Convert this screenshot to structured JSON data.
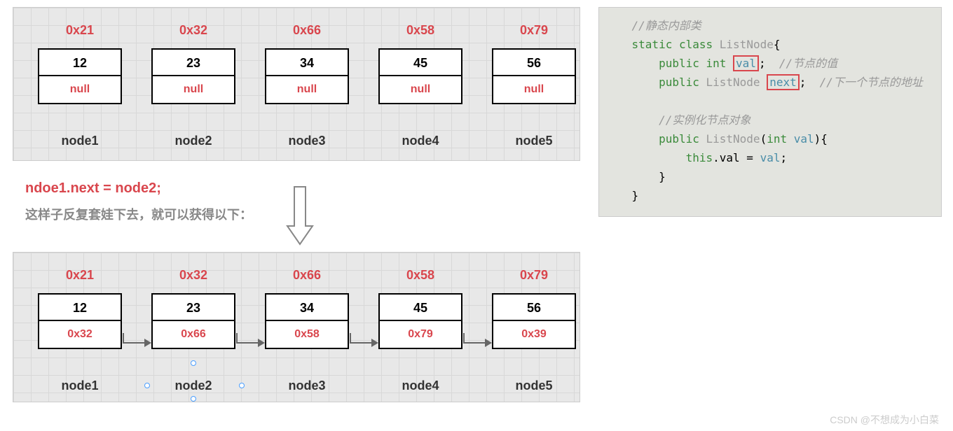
{
  "diagram1": {
    "nodes": [
      {
        "addr": "0x21",
        "val": "12",
        "ptr": "null",
        "name": "node1"
      },
      {
        "addr": "0x32",
        "val": "23",
        "ptr": "null",
        "name": "node2"
      },
      {
        "addr": "0x66",
        "val": "34",
        "ptr": "null",
        "name": "node3"
      },
      {
        "addr": "0x58",
        "val": "45",
        "ptr": "null",
        "name": "node4"
      },
      {
        "addr": "0x79",
        "val": "56",
        "ptr": "null",
        "name": "node5"
      }
    ]
  },
  "mid": {
    "assignment": "ndoe1.next = node2;",
    "desc": "这样子反复套娃下去，就可以获得以下："
  },
  "diagram2": {
    "nodes": [
      {
        "addr": "0x21",
        "val": "12",
        "ptr": "0x32",
        "name": "node1"
      },
      {
        "addr": "0x32",
        "val": "23",
        "ptr": "0x66",
        "name": "node2"
      },
      {
        "addr": "0x66",
        "val": "34",
        "ptr": "0x58",
        "name": "node3"
      },
      {
        "addr": "0x58",
        "val": "45",
        "ptr": "0x79",
        "name": "node4"
      },
      {
        "addr": "0x79",
        "val": "56",
        "ptr": "0x39",
        "name": "node5"
      }
    ]
  },
  "code": {
    "c1": "//静态内部类",
    "c2a": "static",
    "c2b": "class",
    "c2c": "ListNode",
    "c2d": "{",
    "c3a": "public",
    "c3b": "int",
    "c3c": "val",
    "c3d": ";",
    "c3e": "//节点的值",
    "c4a": "public",
    "c4b": "ListNode",
    "c4c": "next",
    "c4d": ";",
    "c4e": "//下一个节点的地址",
    "c5": "//实例化节点对象",
    "c6a": "public",
    "c6b": "ListNode",
    "c6c": "(",
    "c6d": "int",
    "c6e": "val",
    "c6f": "){",
    "c7a": "this",
    "c7b": ".val = ",
    "c7c": "val",
    "c7d": ";",
    "c8": "}",
    "c9": "}"
  },
  "watermark": "CSDN @不想成为小白菜"
}
